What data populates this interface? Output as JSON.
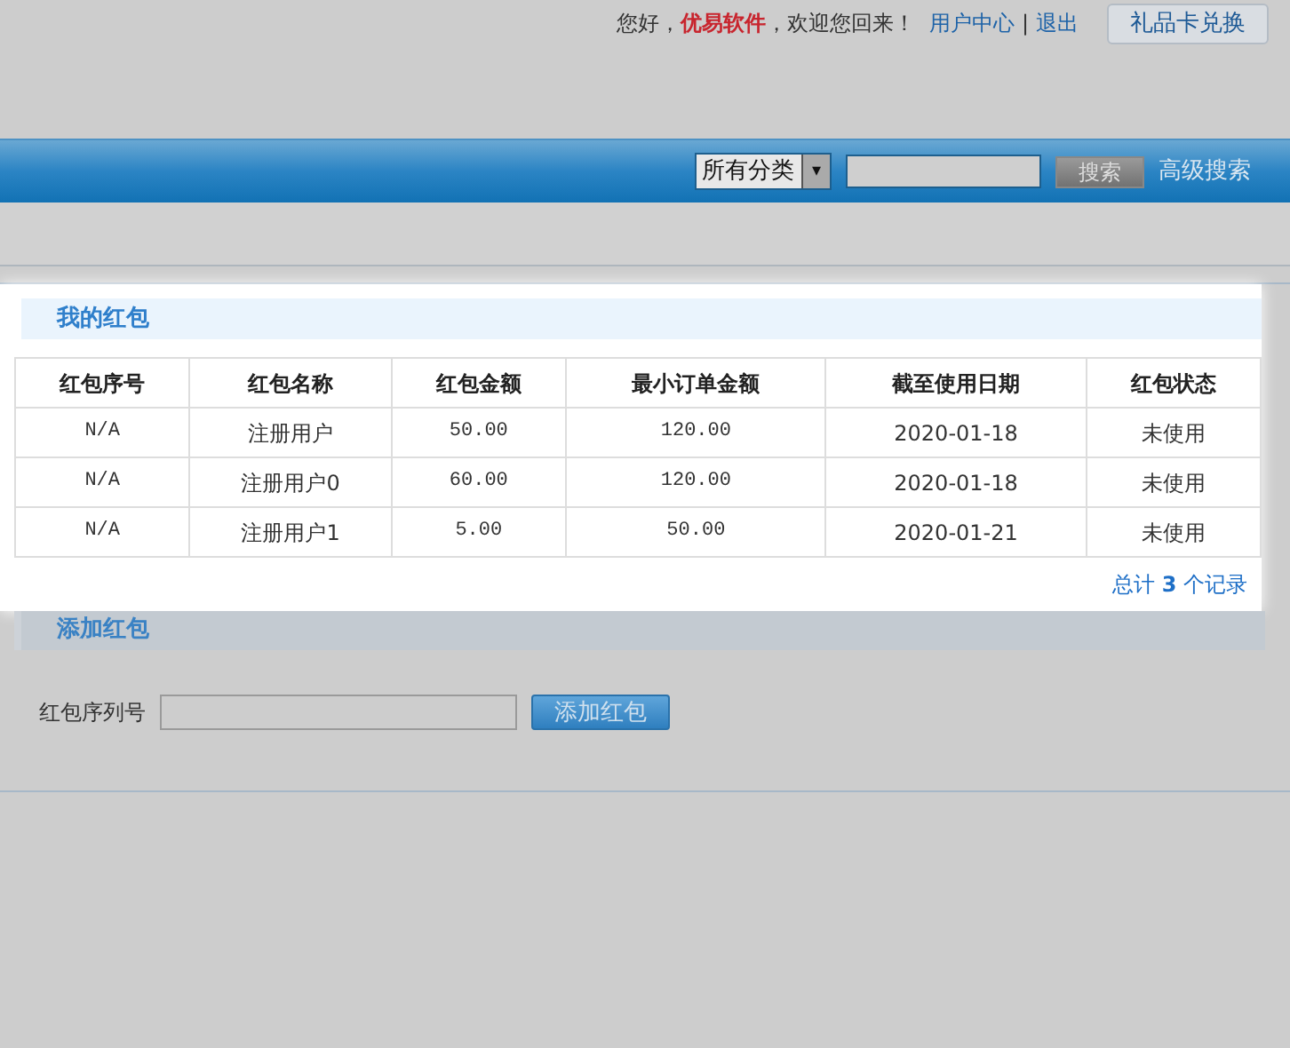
{
  "header": {
    "greeting": "您好，",
    "user": "优易软件",
    "welcome": "，欢迎您回来！",
    "links": [
      "用户中心",
      "退出"
    ],
    "separator": "|",
    "gift_button": "礼品卡兑换"
  },
  "search_bar": {
    "category": "所有分类",
    "caret": "▾",
    "button": "搜索",
    "advanced_link": "高级搜索"
  },
  "my_coupons": {
    "title": "我的红包",
    "table": {
      "columns": [
        "红包序号",
        "红包名称",
        "红包金额",
        "最小订单金额",
        "截至使用日期",
        "红包状态"
      ],
      "rows": [
        [
          "N/A",
          "注册用户",
          "50.00",
          "120.00",
          "2020-01-18",
          "未使用"
        ],
        [
          "N/A",
          "注册用户0",
          "60.00",
          "120.00",
          "2020-01-18",
          "未使用"
        ],
        [
          "N/A",
          "注册用户1",
          "5.00",
          "50.00",
          "2020-01-21",
          "未使用"
        ]
      ]
    },
    "total": {
      "before": "总计",
      "count": "3",
      "after": "个记录"
    }
  },
  "add_coupon": {
    "title": "添加红包",
    "field_label": "红包序列号",
    "button": "添加红包"
  }
}
